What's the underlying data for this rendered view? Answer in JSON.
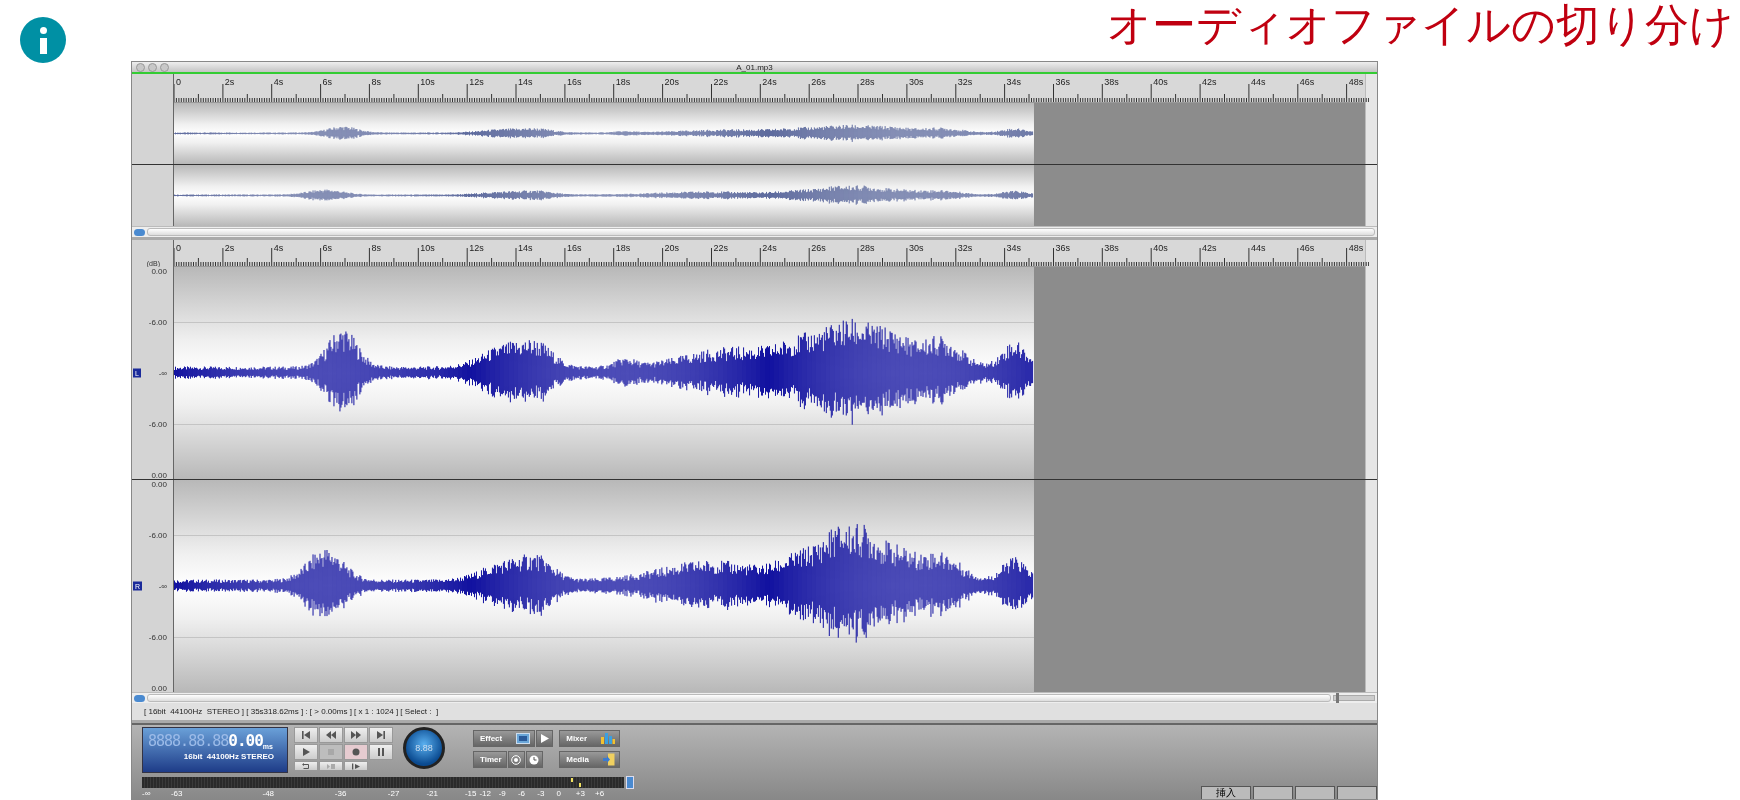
{
  "header": {
    "title": "オーディオファイルの切り分け"
  },
  "window": {
    "title": "A_01.mp3"
  },
  "overview": {
    "ruler_labels": [
      "0",
      "2s",
      "4s",
      "6s",
      "8s",
      "10s",
      "12s",
      "14s",
      "16s",
      "18s",
      "20s",
      "22s",
      "24s",
      "26s",
      "28s",
      "30s",
      "32s",
      "34s",
      "36s",
      "38s",
      "40s",
      "42s",
      "44s",
      "46s",
      "48s"
    ]
  },
  "editor": {
    "ruler_labels": [
      "0",
      "2s",
      "4s",
      "6s",
      "8s",
      "10s",
      "12s",
      "14s",
      "16s",
      "18s",
      "20s",
      "22s",
      "24s",
      "26s",
      "28s",
      "30s",
      "32s",
      "34s",
      "36s",
      "38s",
      "40s",
      "42s",
      "44s",
      "46s",
      "48s"
    ],
    "unit": "(dB)",
    "channels": [
      {
        "label": "L",
        "scale": [
          "0.00",
          "-6.00",
          "-∞",
          "-6.00",
          "0.00"
        ]
      },
      {
        "label": "R",
        "scale": [
          "0.00",
          "-6.00",
          "-∞",
          "-6.00",
          "0.00"
        ]
      }
    ]
  },
  "zoom_slider": {
    "level": 0.05
  },
  "status_line": "[ 16bit  44100Hz  STEREO ] [ 35s318.62ms ] : [ > 0.00ms ] [ x 1 : 1024 ] [ Select :  ]",
  "transport": {
    "display": {
      "ghost": "8888.88.88",
      "time": "0.00",
      "unit": "ms",
      "format": "16bit  44100Hz STEREO"
    },
    "knob": "8.88",
    "actions": [
      {
        "label": "Effect",
        "kind": "effect"
      },
      {
        "label": "Mixer",
        "kind": "mixer"
      },
      {
        "label": "Timer",
        "kind": "timer"
      },
      {
        "label": "Media",
        "kind": "media"
      }
    ],
    "meter_scale": [
      "-∞",
      "-63",
      "-48",
      "-36",
      "-27",
      "-21",
      "-15",
      "-12",
      "-9",
      "-6",
      "-3",
      "0",
      "+3",
      "+6"
    ]
  },
  "bottom_tabs": [
    {
      "label": "挿入"
    }
  ]
}
